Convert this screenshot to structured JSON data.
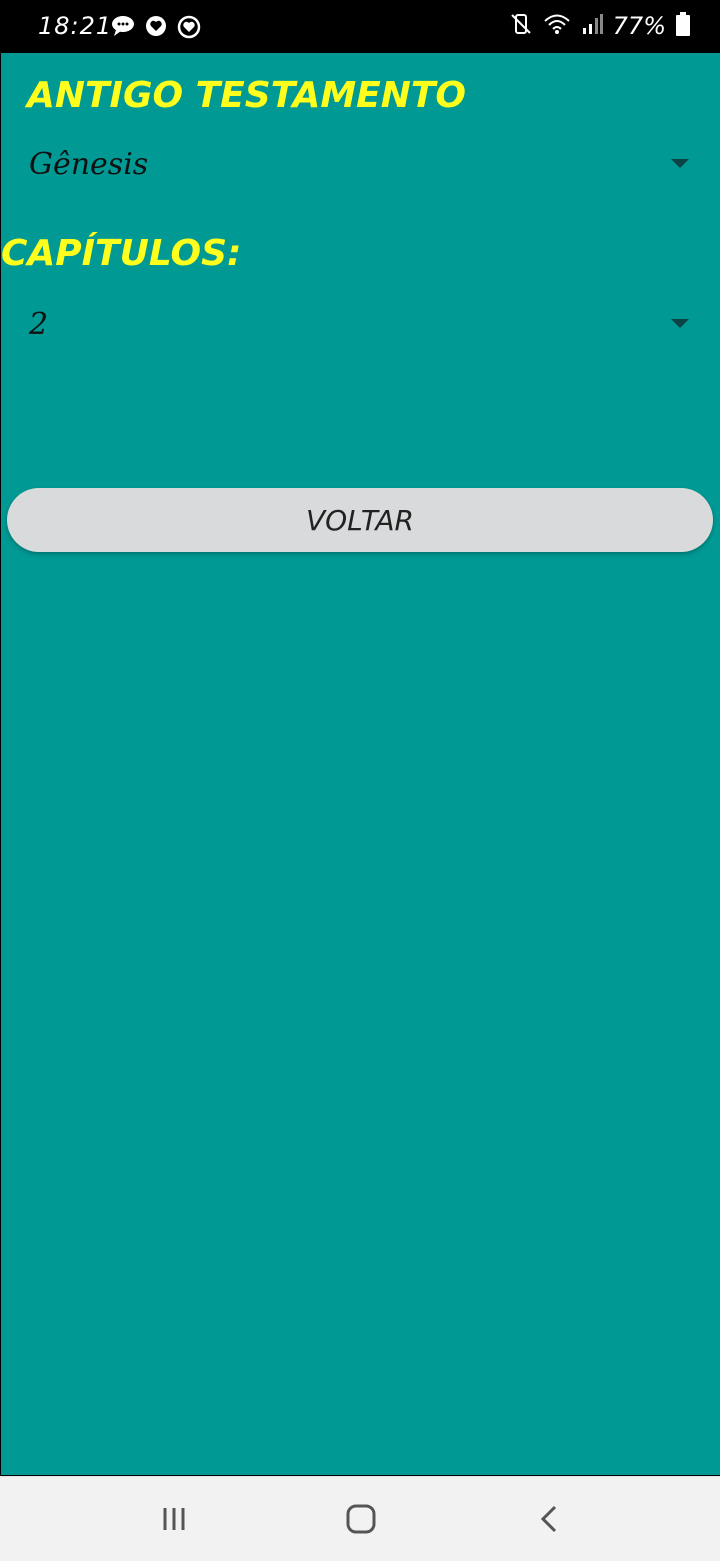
{
  "status_bar": {
    "time": "18:21",
    "battery": "77%"
  },
  "book_section": {
    "title": "ANTIGO TESTAMENTO",
    "selected_book": "Gênesis"
  },
  "chapter_section": {
    "title": "CAPÍTULOS:",
    "selected_chapter": "2"
  },
  "buttons": {
    "back_label": "VOLTAR"
  },
  "colors": {
    "background": "#009994",
    "title_yellow": "#ffff1e",
    "button_gray": "#d9dadb"
  },
  "icons": {
    "left": [
      "chat-bubble-icon",
      "heart-speech-icon",
      "heart-outline-icon"
    ],
    "right": [
      "mute-vibrate-icon",
      "wifi-icon",
      "signal-icon",
      "battery-icon"
    ],
    "nav": [
      "recent-apps-icon",
      "home-icon",
      "back-icon"
    ]
  }
}
